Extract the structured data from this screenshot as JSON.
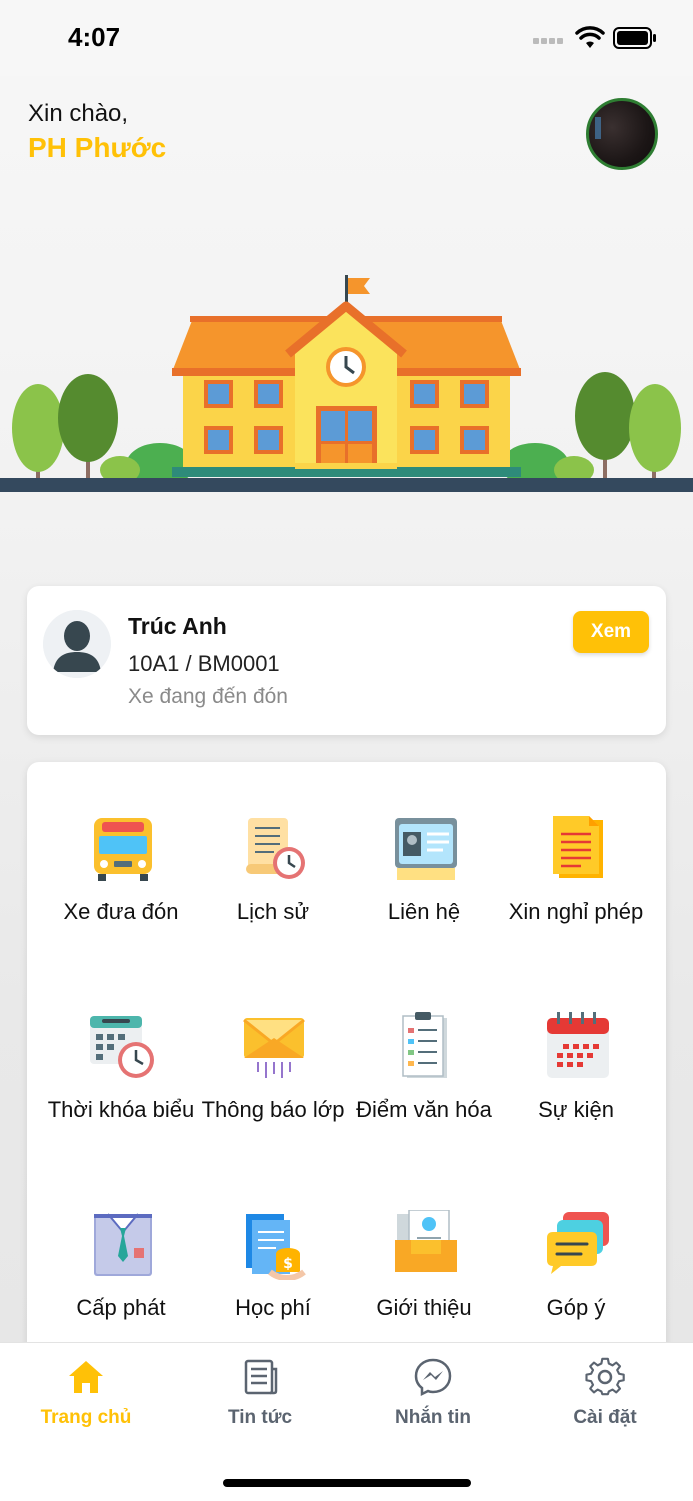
{
  "status_bar": {
    "time": "4:07"
  },
  "header": {
    "greeting": "Xin chào,",
    "user_name": "PH Phước"
  },
  "student": {
    "name": "Trúc Anh",
    "class_code": "10A1 / BM0001",
    "status": "Xe đang đến đón",
    "view_button": "Xem"
  },
  "menu": [
    {
      "label": "Xe đưa đón",
      "icon": "school-bus-icon"
    },
    {
      "label": "Lịch sử",
      "icon": "history-scroll-icon"
    },
    {
      "label": "Liên hệ",
      "icon": "contact-card-icon"
    },
    {
      "label": "Xin nghỉ phép",
      "icon": "leave-document-icon"
    },
    {
      "label": "Thời khóa biểu",
      "icon": "timetable-icon"
    },
    {
      "label": "Thông báo lớp",
      "icon": "mail-icon"
    },
    {
      "label": "Điểm văn hóa",
      "icon": "grades-icon"
    },
    {
      "label": "Sự kiện",
      "icon": "calendar-icon"
    },
    {
      "label": "Cấp phát",
      "icon": "uniform-icon"
    },
    {
      "label": "Học phí",
      "icon": "tuition-fee-icon"
    },
    {
      "label": "Giới thiệu",
      "icon": "introduction-icon"
    },
    {
      "label": "Góp ý",
      "icon": "feedback-icon"
    }
  ],
  "tabbar": [
    {
      "label": "Trang chủ",
      "icon": "home-icon",
      "active": true
    },
    {
      "label": "Tin tức",
      "icon": "news-icon",
      "active": false
    },
    {
      "label": "Nhắn tin",
      "icon": "messenger-icon",
      "active": false
    },
    {
      "label": "Cài đặt",
      "icon": "settings-gear-icon",
      "active": false
    }
  ],
  "colors": {
    "accent": "#FFC107",
    "tab_inactive": "#5b6470",
    "school_wall": "#FBD449",
    "roof": "#F5952C"
  }
}
